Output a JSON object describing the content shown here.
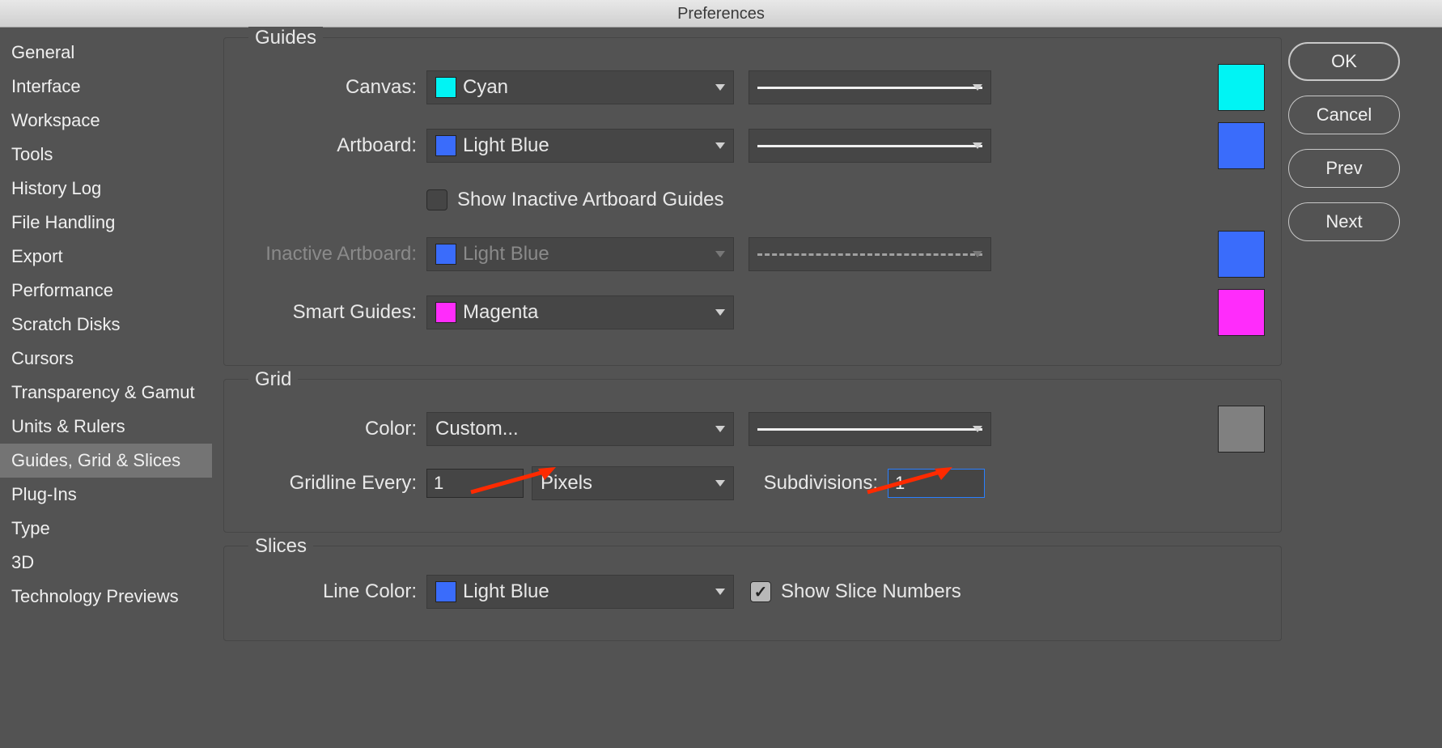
{
  "title": "Preferences",
  "buttons": {
    "ok": "OK",
    "cancel": "Cancel",
    "prev": "Prev",
    "next": "Next"
  },
  "sidebar": {
    "items": [
      "General",
      "Interface",
      "Workspace",
      "Tools",
      "History Log",
      "File Handling",
      "Export",
      "Performance",
      "Scratch Disks",
      "Cursors",
      "Transparency & Gamut",
      "Units & Rulers",
      "Guides, Grid & Slices",
      "Plug-Ins",
      "Type",
      "3D",
      "Technology Previews"
    ],
    "selected": 12
  },
  "guides": {
    "legend": "Guides",
    "canvas_label": "Canvas:",
    "canvas_color_name": "Cyan",
    "canvas_color_hex": "#00F4F4",
    "artboard_label": "Artboard:",
    "artboard_color_name": "Light Blue",
    "artboard_color_hex": "#3A6CFB",
    "show_inactive_label": "Show Inactive Artboard Guides",
    "show_inactive_checked": false,
    "inactive_label": "Inactive Artboard:",
    "inactive_color_name": "Light Blue",
    "inactive_color_hex": "#3A6CFB",
    "smart_label": "Smart Guides:",
    "smart_color_name": "Magenta",
    "smart_color_hex": "#FF2CFB"
  },
  "grid": {
    "legend": "Grid",
    "color_label": "Color:",
    "color_name": "Custom...",
    "color_hex": "#808080",
    "gridline_label": "Gridline Every:",
    "gridline_value": "1",
    "gridline_unit": "Pixels",
    "subdiv_label": "Subdivisions:",
    "subdiv_value": "1"
  },
  "slices": {
    "legend": "Slices",
    "line_color_label": "Line Color:",
    "line_color_name": "Light Blue",
    "line_color_hex": "#3A6CFB",
    "show_numbers_label": "Show Slice Numbers",
    "show_numbers_checked": true
  }
}
